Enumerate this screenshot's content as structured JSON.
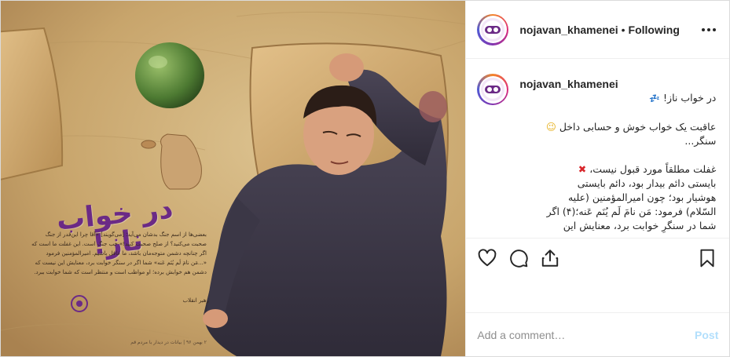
{
  "header": {
    "username": "nojavan_khamenei",
    "separator": "•",
    "follow_status": "Following"
  },
  "caption": {
    "username": "nojavan_khamenei",
    "lines": [
      "در خواب ناز!",
      "عاقبت یک خواب خوش و حسابی داخل",
      "سنگر...",
      "غفلت مطلقاً مورد قبول نیست،",
      "بایستی دائم بیدار بود، دائم بایستی",
      "هوشیار بود؛ چون امیرالمؤمنین (علیه",
      "السّلام) فرمود: مَن نامَ لَم یُنَم عَنه؛(۴) اگر",
      "شما در سنگرِ خوابت برد، معنایش این"
    ],
    "emoji": {
      "zz": "💤",
      "smile": "😉",
      "cross": "✖"
    }
  },
  "poster": {
    "title": "در خواب ناز!",
    "body": [
      "بعضی‌ها از اسم جنگ بدشان می‌آید؛ [می‌گویند] «آقا چرا این‌قدر از جنگ",
      "صحبت می‌کنید؟ از صلح صحبت کنید!» خب جنگ است. این غفلت ما است که",
      "اگر چنانچه دشمن متوجه‌مان باشد، ما غافل باشیم. امیرالمؤمنین فرمود",
      "«...مَن نامَ لَم یُنَم عَنه» شما اگر در سنگر خوابت برد، معنایش این نیست که",
      "دشمن هم خوابش برده؛ او مواظب است و منتظر است که شما خوابت ببرد."
    ],
    "signature": "رهبر انقلاب",
    "footnote": "۲ بهمن ۹۶ | بیانات در دیدار با مردم قم"
  },
  "actions": {
    "like": "heart-icon",
    "comment": "comment-icon",
    "share": "share-icon",
    "save": "bookmark-icon"
  },
  "comment_box": {
    "placeholder": "Add a comment…",
    "post_label": "Post"
  },
  "colors": {
    "accent_blue": "#0095f6",
    "post_disabled": "#b2dffc",
    "poster_purple": "#6b2a86",
    "border": "#dbdbdb"
  }
}
